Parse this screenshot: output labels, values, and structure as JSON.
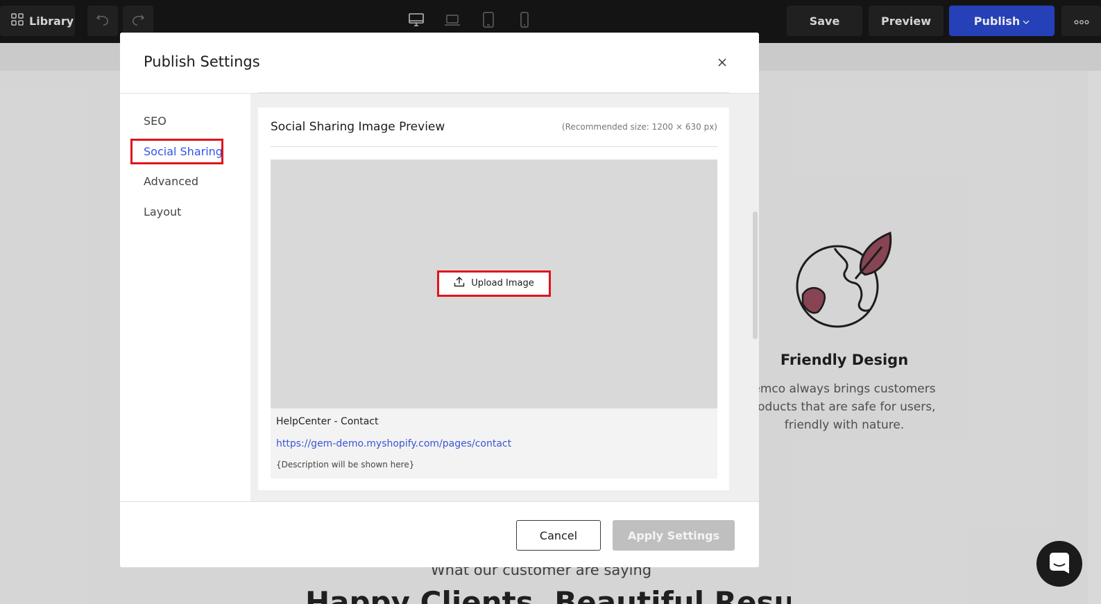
{
  "toolbar": {
    "library_label": "Library",
    "save_label": "Save",
    "preview_label": "Preview",
    "publish_label": "Publish",
    "publish_color": "#2a46c8",
    "device_icons": [
      "desktop-icon",
      "laptop-icon",
      "tablet-icon",
      "mobile-icon"
    ]
  },
  "background_page": {
    "feature_title": "Friendly Design",
    "feature_text": "emco always brings customers roducts that are safe for users, friendly with nature.",
    "section_subtitle": "What our customer are saying",
    "section_heading": "Happy Clients, Beautiful Result"
  },
  "modal": {
    "title": "Publish Settings",
    "nav": [
      {
        "label": "SEO",
        "active": false
      },
      {
        "label": "Social Sharing",
        "active": true
      },
      {
        "label": "Advanced",
        "active": false
      },
      {
        "label": "Layout",
        "active": false
      }
    ],
    "active_color": "#2f54eb",
    "highlight_color": "#e0141c",
    "card": {
      "title": "Social Sharing Image Preview",
      "hint": "(Recommended size: 1200 × 630 px)",
      "upload_label": "Upload Image",
      "page_title": "HelpCenter - Contact",
      "page_url": "https://gem-demo.myshopify.com/pages/contact",
      "description": "{Description will be shown here}"
    },
    "footer": {
      "cancel_label": "Cancel",
      "apply_label": "Apply Settings"
    }
  }
}
